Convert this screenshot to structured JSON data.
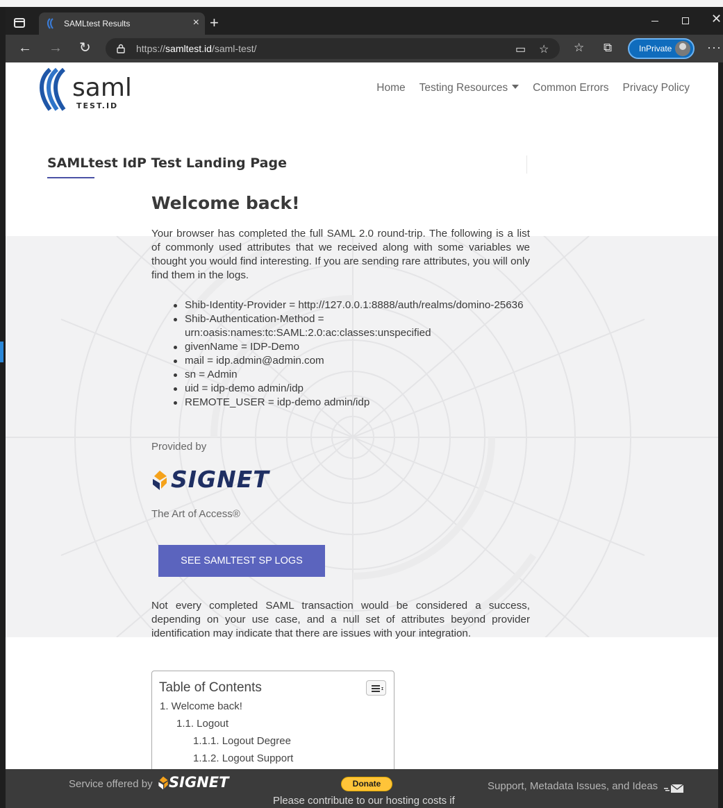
{
  "browser": {
    "tab_title": "SAMLtest Results",
    "tab_close": "×",
    "new_tab": "+",
    "url_prefix": "https://",
    "url_host": "samltest.id",
    "url_path": "/saml-test/",
    "inprivate_label": "InPrivate",
    "back": "←",
    "forward": "→",
    "refresh": "↻",
    "more": "···"
  },
  "site": {
    "logo_text": "saml",
    "logo_sub": "TEST.ID",
    "nav": [
      "Home",
      "Testing Resources",
      "Common Errors",
      "Privacy Policy"
    ]
  },
  "page": {
    "heading": "SAMLtest IdP Test Landing Page",
    "welcome": "Welcome back!",
    "intro": "Your browser has completed the full SAML 2.0 round-trip. The following is a list of commonly used attributes that we received along with some variables we thought you would find interesting. If you are sending rare attributes, you will only find them in the logs.",
    "attributes": [
      "Shib-Identity-Provider = http://127.0.0.1:8888/auth/realms/domino-25636",
      "Shib-Authentication-Method = urn:oasis:names:tc:SAML:2.0:ac:classes:unspecified",
      "givenName = IDP-Demo",
      "mail = idp.admin@admin.com",
      "sn = Admin",
      "uid = idp-demo admin/idp",
      "REMOTE_USER = idp-demo admin/idp"
    ],
    "provided_by": "Provided by",
    "provider_name": "SIGNET",
    "tagline": "The Art of Access®",
    "cta": "SEE SAMLTEST SP LOGS",
    "closing": "Not every completed SAML transaction would be considered a success, depending on your use case, and a null set of attributes beyond provider identification may indicate that there are issues with your integration."
  },
  "toc": {
    "title": "Table of Contents",
    "items": [
      "1. Welcome back!",
      "1.1. Logout",
      "1.1.1. Logout Degree",
      "1.1.2. Logout Support"
    ]
  },
  "footer": {
    "service_offered": "Service offered by",
    "signet": "SIGNET",
    "donate": "Donate",
    "contribute": "Please contribute to our hosting costs if",
    "support": "Support, Metadata Issues, and Ideas"
  },
  "colors": {
    "accent": "#5b64be",
    "heading_underline": "#4a51a5",
    "logo_blue": "#1f57a8",
    "signet_navy": "#1f2f63",
    "signet_orange": "#f5a21b",
    "inprivate": "#0f6cbd"
  }
}
